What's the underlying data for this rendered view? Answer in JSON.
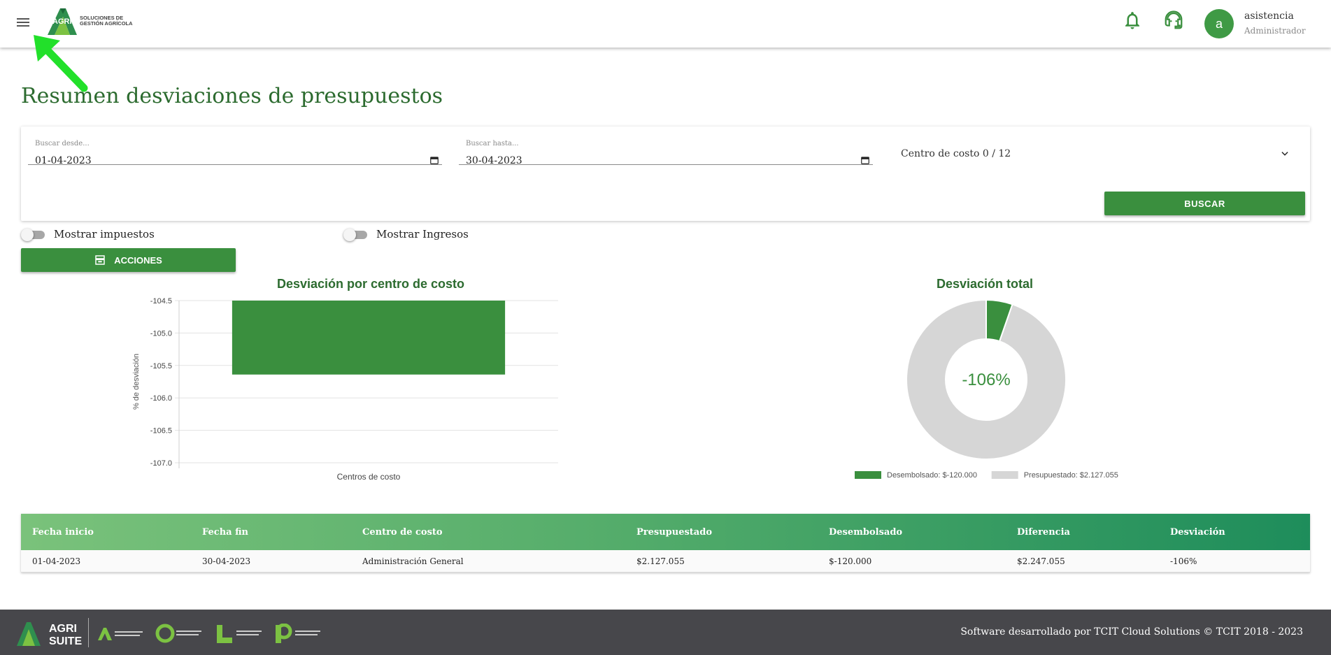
{
  "header": {
    "logo_text": "AGRI",
    "logo_tagline_1": "SOLUCIONES DE",
    "logo_tagline_2": "GESTIÓN AGRÍCOLA",
    "avatar_letter": "a",
    "user_name": "asistencia",
    "user_role": "Administrador"
  },
  "page": {
    "title": "Resumen desviaciones de presupuestos"
  },
  "filters": {
    "from_label": "Buscar desde...",
    "from_value": "01-04-2023",
    "to_label": "Buscar hasta...",
    "to_value": "30-04-2023",
    "cost_center": "Centro de costo 0 / 12",
    "search_button": "BUSCAR"
  },
  "toggles": {
    "show_taxes": "Mostrar impuestos",
    "show_income": "Mostrar Ingresos"
  },
  "actions_button": "ACCIONES",
  "chart_data": [
    {
      "type": "bar",
      "title": "Desviación por centro de costo",
      "xlabel": "Centros de costo",
      "ylabel": "% de desviación",
      "categories": [
        "Administración General"
      ],
      "values": [
        -105.64
      ],
      "ylim": [
        -107.0,
        -104.5
      ],
      "yticks": [
        "-104.5",
        "-105.0",
        "-105.5",
        "-106.0",
        "-106.5",
        "-107.0"
      ],
      "color": "#3a8f3e",
      "grid": true
    },
    {
      "type": "pie",
      "title": "Desviación total",
      "center_label": "-106%",
      "slices": [
        {
          "name": "Desembolsado: $-120.000",
          "value": 120000,
          "color": "#3a8f3e"
        },
        {
          "name": "Presupuestado: $2.127.055",
          "value": 2127055,
          "color": "#d6d6d6"
        }
      ],
      "legend": "bottom"
    }
  ],
  "table": {
    "headers": [
      "Fecha inicio",
      "Fecha fin",
      "Centro de costo",
      "Presupuestado",
      "Desembolsado",
      "Diferencia",
      "Desviación"
    ],
    "rows": [
      [
        "01-04-2023",
        "30-04-2023",
        "Administración General",
        "$2.127.055",
        "$-120.000",
        "$2.247.055",
        "-106%"
      ]
    ]
  },
  "footer": {
    "brand_1": "AGRI",
    "brand_2": "SUITE",
    "text": "Software desarrollado por TCIT Cloud Solutions © TCIT 2018 - 2023"
  },
  "colors": {
    "primary": "#3a8f3e",
    "title": "#2c6b2f",
    "footer_bg": "#47474b"
  }
}
